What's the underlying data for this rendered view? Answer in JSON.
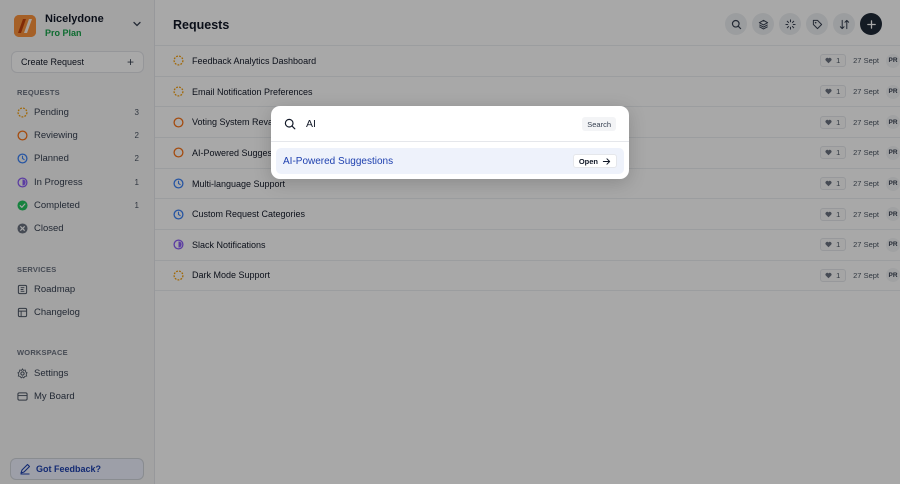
{
  "brand": {
    "name": "Nicelydone",
    "plan": "Pro Plan"
  },
  "sidebar": {
    "create_label": "Create Request",
    "requests_title": "REQUESTS",
    "requests": [
      {
        "label": "Pending",
        "count": "3",
        "icon": "pending-icon",
        "color": "#f59e0b"
      },
      {
        "label": "Reviewing",
        "count": "2",
        "icon": "reviewing-icon",
        "color": "#f97316"
      },
      {
        "label": "Planned",
        "count": "2",
        "icon": "planned-icon",
        "color": "#3b82f6"
      },
      {
        "label": "In Progress",
        "count": "1",
        "icon": "in-progress-icon",
        "color": "#8b5cf6"
      },
      {
        "label": "Completed",
        "count": "1",
        "icon": "completed-icon",
        "color": "#22c55e"
      },
      {
        "label": "Closed",
        "count": "",
        "icon": "closed-icon",
        "color": "#6b7280"
      }
    ],
    "services_title": "SERVICES",
    "services": [
      {
        "label": "Roadmap",
        "icon": "roadmap-icon"
      },
      {
        "label": "Changelog",
        "icon": "changelog-icon"
      }
    ],
    "workspace_title": "WORKSPACE",
    "workspace": [
      {
        "label": "Settings",
        "icon": "gear-icon"
      },
      {
        "label": "My Board",
        "icon": "board-icon"
      }
    ],
    "feedback_label": "Got Feedback?"
  },
  "main": {
    "title": "Requests",
    "toolbar_icons": [
      "search-icon",
      "layers-icon",
      "sparkle-icon",
      "tag-icon",
      "sort-icon",
      "plus-icon"
    ],
    "rows": [
      {
        "title": "Feedback Analytics Dashboard",
        "status": "pending",
        "votes": "1",
        "date": "27 Sept",
        "avatar": "PR"
      },
      {
        "title": "Email Notification Preferences",
        "status": "pending",
        "votes": "1",
        "date": "27 Sept",
        "avatar": "PR"
      },
      {
        "title": "Voting System Revamp",
        "status": "reviewing",
        "votes": "1",
        "date": "27 Sept",
        "avatar": "PR"
      },
      {
        "title": "AI-Powered Suggestions",
        "status": "reviewing",
        "votes": "1",
        "date": "27 Sept",
        "avatar": "PR"
      },
      {
        "title": "Multi-language Support",
        "status": "planned",
        "votes": "1",
        "date": "27 Sept",
        "avatar": "PR"
      },
      {
        "title": "Custom Request Categories",
        "status": "planned",
        "votes": "1",
        "date": "27 Sept",
        "avatar": "PR"
      },
      {
        "title": "Slack Notifications",
        "status": "in-progress",
        "votes": "1",
        "date": "27 Sept",
        "avatar": "PR"
      },
      {
        "title": "Dark Mode Support",
        "status": "pending",
        "votes": "1",
        "date": "27 Sept",
        "avatar": "PR"
      }
    ]
  },
  "search_modal": {
    "query": "AI",
    "search_label": "Search",
    "result_title": "AI-Powered Suggestions",
    "open_label": "Open"
  },
  "colors": {
    "accent": "#1e40af",
    "pending": "#f59e0b",
    "reviewing": "#f97316",
    "planned": "#3b82f6",
    "in_progress": "#8b5cf6",
    "completed": "#22c55e",
    "closed": "#6b7280"
  }
}
